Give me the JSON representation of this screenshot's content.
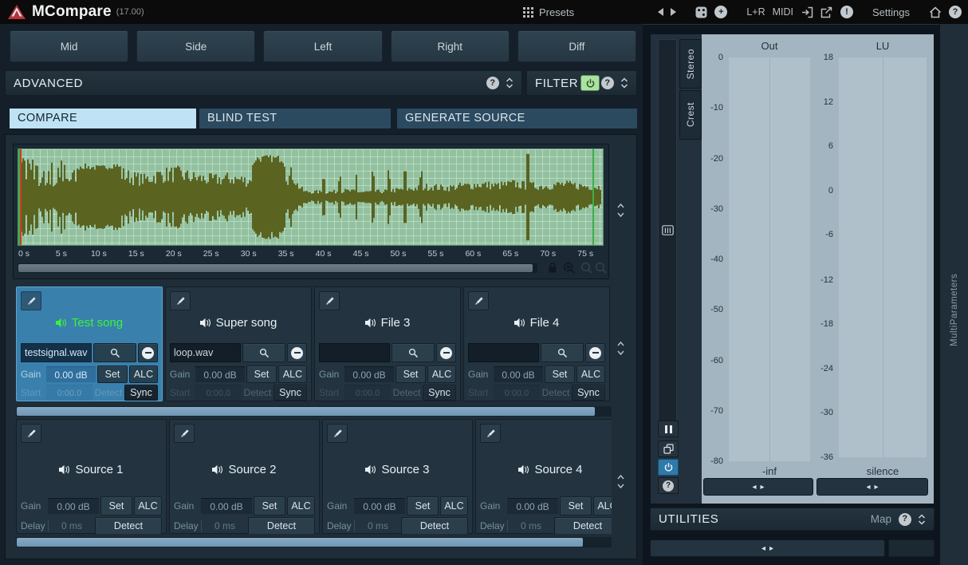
{
  "titlebar": {
    "app": "MCompare",
    "version": "(17.00)",
    "presets": "Presets",
    "lr": "L+R",
    "midi": "MIDI",
    "settings": "Settings",
    "help": "?",
    "alert": "!",
    "plus": "+"
  },
  "channel_buttons": [
    "Mid",
    "Side",
    "Left",
    "Right",
    "Diff"
  ],
  "advanced": {
    "label": "ADVANCED",
    "help": "?"
  },
  "filter": {
    "label": "FILTER",
    "help": "?"
  },
  "tabs": {
    "compare": "COMPARE",
    "blind": "BLIND TEST",
    "generate": "GENERATE SOURCE"
  },
  "waveform": {
    "duration_s": 77,
    "time_labels": [
      {
        "label": "0 s",
        "t": 0
      },
      {
        "label": "5 s",
        "t": 5
      },
      {
        "label": "10 s",
        "t": 10
      },
      {
        "label": "15 s",
        "t": 15
      },
      {
        "label": "20 s",
        "t": 20
      },
      {
        "label": "25 s",
        "t": 25
      },
      {
        "label": "30 s",
        "t": 30
      },
      {
        "label": "35 s",
        "t": 35
      },
      {
        "label": "40 s",
        "t": 40
      },
      {
        "label": "45 s",
        "t": 45
      },
      {
        "label": "50 s",
        "t": 50
      },
      {
        "label": "55 s",
        "t": 55
      },
      {
        "label": "60 s",
        "t": 60
      },
      {
        "label": "65 s",
        "t": 65
      },
      {
        "label": "70 s",
        "t": 70
      },
      {
        "label": "75 s",
        "t": 75
      }
    ],
    "envelope": [
      [
        0,
        0.34
      ],
      [
        0.02,
        0.5
      ],
      [
        0.05,
        0.42
      ],
      [
        0.08,
        0.48
      ],
      [
        0.105,
        0.75
      ],
      [
        0.14,
        0.7
      ],
      [
        0.165,
        0.78
      ],
      [
        0.19,
        0.6
      ],
      [
        0.215,
        0.52
      ],
      [
        0.24,
        0.66
      ],
      [
        0.27,
        0.7
      ],
      [
        0.3,
        0.58
      ],
      [
        0.33,
        0.52
      ],
      [
        0.365,
        0.56
      ],
      [
        0.395,
        0.48
      ],
      [
        0.405,
        0.93
      ],
      [
        0.452,
        0.93
      ],
      [
        0.462,
        0.55
      ],
      [
        0.468,
        0.72
      ],
      [
        0.478,
        0.35
      ],
      [
        0.49,
        0.16
      ],
      [
        0.53,
        0.15
      ],
      [
        0.56,
        0.19
      ],
      [
        0.59,
        0.15
      ],
      [
        0.62,
        0.17
      ],
      [
        0.65,
        0.21
      ],
      [
        0.68,
        0.26
      ],
      [
        0.705,
        0.32
      ],
      [
        0.73,
        0.27
      ],
      [
        0.76,
        0.33
      ],
      [
        0.79,
        0.38
      ],
      [
        0.82,
        0.34
      ],
      [
        0.85,
        0.4
      ],
      [
        0.87,
        0.34
      ],
      [
        0.9,
        0.33
      ],
      [
        0.93,
        0.38
      ],
      [
        0.96,
        0.34
      ],
      [
        1,
        0.3
      ]
    ]
  },
  "slot_labels": {
    "gain": "Gain",
    "set": "Set",
    "alc": "ALC",
    "start": "Start",
    "detect": "Detect",
    "sync": "Sync",
    "delay": "Delay"
  },
  "file_slots": [
    {
      "title": "Test song",
      "filename": "testsignal.wav",
      "gain_value": "0.00 dB",
      "start_value": "0:00.0"
    },
    {
      "title": "Super song",
      "filename": "loop.wav",
      "gain_value": "0.00 dB",
      "start_value": "0:00.0"
    },
    {
      "title": "File 3",
      "filename": "",
      "gain_value": "0.00 dB",
      "start_value": "0:00.0"
    },
    {
      "title": "File 4",
      "filename": "",
      "gain_value": "0.00 dB",
      "start_value": "0:00.0"
    }
  ],
  "source_slots": [
    {
      "title": "Source 1",
      "gain_value": "0.00 dB",
      "delay_value": "0 ms"
    },
    {
      "title": "Source 2",
      "gain_value": "0.00 dB",
      "delay_value": "0 ms"
    },
    {
      "title": "Source 3",
      "gain_value": "0.00 dB",
      "delay_value": "0 ms"
    },
    {
      "title": "Source 4",
      "gain_value": "0.00 dB",
      "delay_value": "0 ms"
    }
  ],
  "meters": {
    "out": {
      "title": "Out",
      "bottom_label": "-inf",
      "ticks": [
        {
          "label": "0",
          "pct": 0
        },
        {
          "label": "-10",
          "pct": 12.5
        },
        {
          "label": "-20",
          "pct": 25
        },
        {
          "label": "-30",
          "pct": 37.5
        },
        {
          "label": "-40",
          "pct": 50
        },
        {
          "label": "-50",
          "pct": 62.5
        },
        {
          "label": "-60",
          "pct": 75
        },
        {
          "label": "-70",
          "pct": 87.5
        },
        {
          "label": "-80",
          "pct": 100
        }
      ]
    },
    "lu": {
      "title": "LU",
      "bottom_label": "silence",
      "ticks": [
        {
          "label": "18",
          "pct": 0
        },
        {
          "label": "12",
          "pct": 11.1
        },
        {
          "label": "6",
          "pct": 22.2
        },
        {
          "label": "0",
          "pct": 33.3
        },
        {
          "label": "-6",
          "pct": 44.4
        },
        {
          "label": "-12",
          "pct": 55.6
        },
        {
          "label": "-18",
          "pct": 66.7
        },
        {
          "label": "-24",
          "pct": 77.8
        },
        {
          "label": "-30",
          "pct": 88.9
        },
        {
          "label": "-36",
          "pct": 100
        }
      ]
    }
  },
  "side_tabs": {
    "stereo": "Stereo",
    "crest": "Crest"
  },
  "utilities": {
    "label": "UTILITIES",
    "map": "Map",
    "help": "?"
  },
  "right_strip": {
    "label": "MultiParameters"
  },
  "colors": {
    "selected_slot": "#3a80ad",
    "selected_title_green": "#3bf23b",
    "tab_active": "#bfe3f5",
    "power_on_green": "#a9e39f",
    "wave_background": "#93c1a0",
    "wave_ink": "#5a6320",
    "light_scrollbar": "#7fa5c1",
    "meter_background": "#a3b5c1"
  }
}
